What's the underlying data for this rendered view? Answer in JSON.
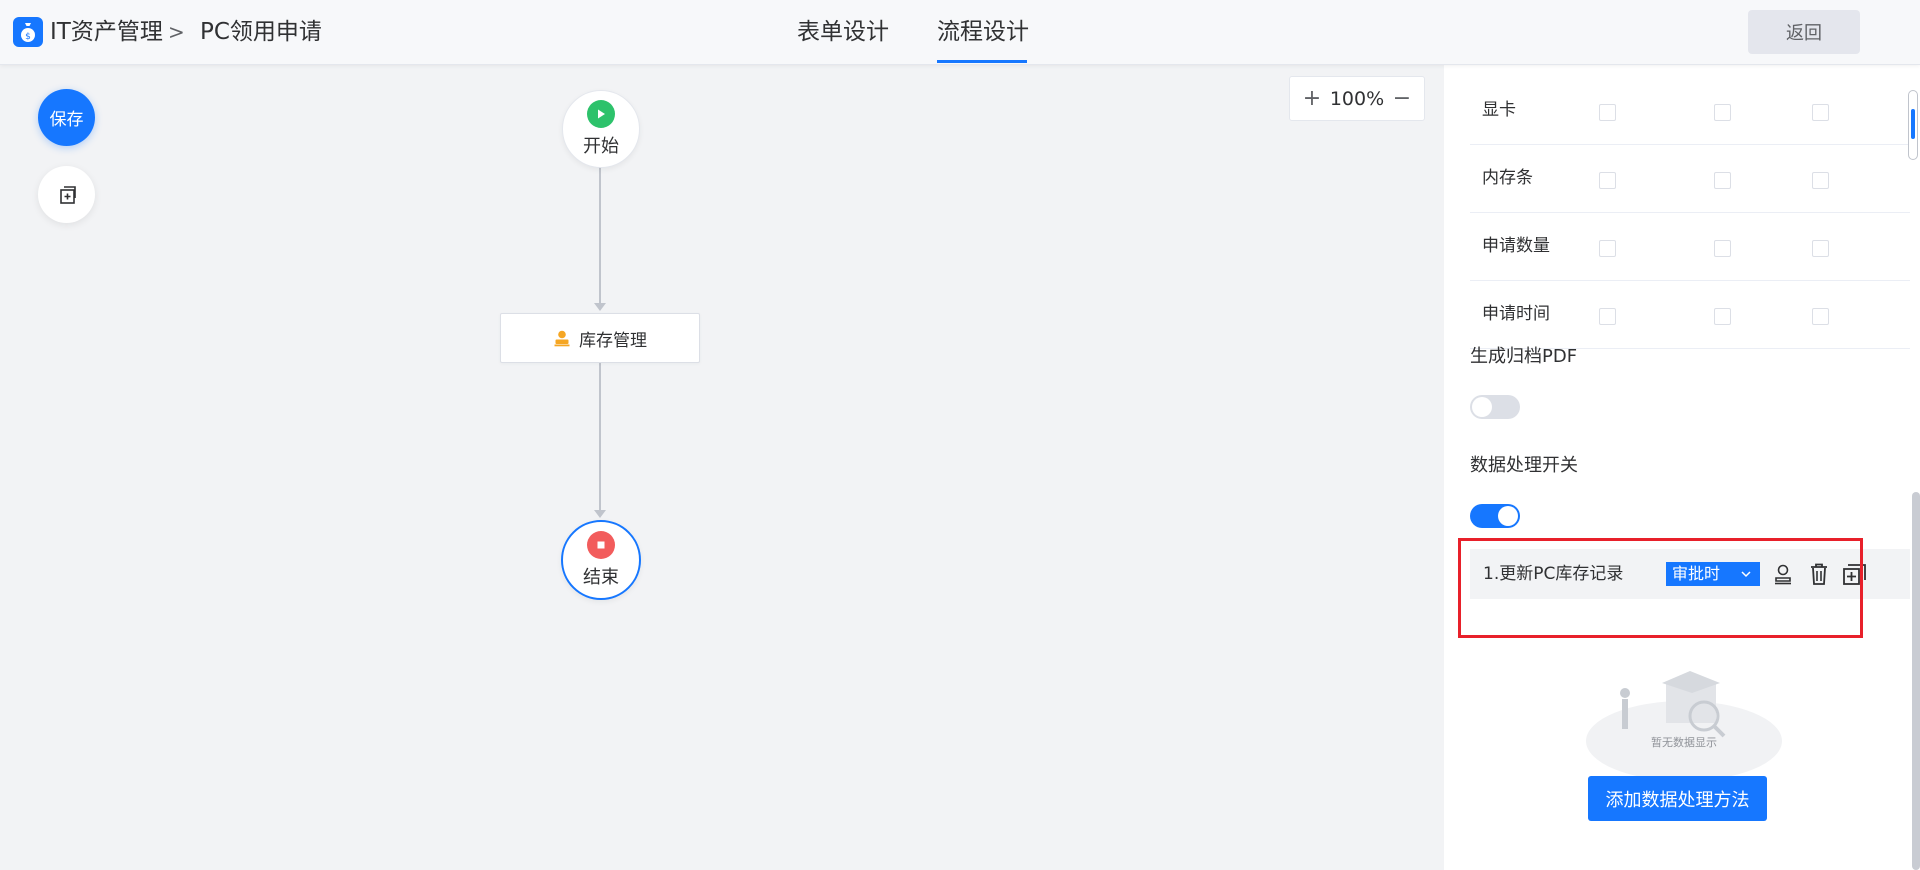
{
  "header": {
    "app_name": "IT资产管理",
    "separator": ">",
    "page_name": "PC领用申请",
    "tabs": [
      {
        "label": "表单设计",
        "active": false
      },
      {
        "label": "流程设计",
        "active": true
      }
    ],
    "back_label": "返回"
  },
  "toolbar": {
    "save_label": "保存",
    "copy_icon": "copy-add-icon"
  },
  "zoom": {
    "plus": "+",
    "value": "100%",
    "minus": "−"
  },
  "flow": {
    "start_label": "开始",
    "task_label": "库存管理",
    "end_label": "结束"
  },
  "panel": {
    "permission_rows": [
      "显卡",
      "内存条",
      "申请数量",
      "申请时间"
    ],
    "pdf_title": "生成归档PDF",
    "pdf_enabled": false,
    "data_switch_title": "数据处理开关",
    "data_switch_enabled": true,
    "method": {
      "name": "1.更新PC库存记录",
      "timing": "审批时"
    },
    "empty_text": "暂无数据显示",
    "add_method_label": "添加数据处理方法"
  },
  "colors": {
    "accent": "#1677ff",
    "start_green": "#2dc26b",
    "end_red": "#f25c5c",
    "task_orange": "#f5a623",
    "highlight_red": "#e8202a"
  }
}
